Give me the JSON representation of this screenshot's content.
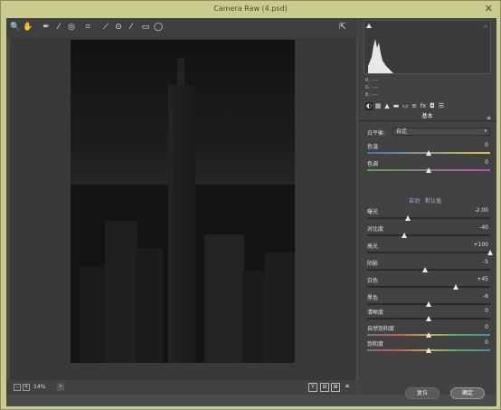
{
  "window": {
    "title": "Camera Raw (4.psd)",
    "close_glyph": "✕"
  },
  "toolbar": {
    "tools": [
      {
        "name": "zoom-icon",
        "glyph": "🔍"
      },
      {
        "name": "hand-icon",
        "glyph": "✋"
      },
      {
        "name": "white-balance-icon",
        "glyph": "✒"
      },
      {
        "name": "color-sampler-icon",
        "glyph": "⁄"
      },
      {
        "name": "targeted-adjust-icon",
        "glyph": "◎"
      },
      {
        "name": "crop-icon",
        "glyph": "⌗"
      },
      {
        "name": "straighten-icon",
        "glyph": "⟋"
      },
      {
        "name": "redeye-icon",
        "glyph": "⊙"
      },
      {
        "name": "brush-icon",
        "glyph": "⁄"
      },
      {
        "name": "graduated-filter-icon",
        "glyph": "▭"
      },
      {
        "name": "radial-filter-icon",
        "glyph": "◯"
      }
    ],
    "export_glyph": "⇱"
  },
  "histogram": {
    "r": "R :",
    "g": "G :",
    "b": "B :",
    "r_val": "---",
    "g_val": "---",
    "b_val": "---"
  },
  "panel_tabs": [
    "◐",
    "▦",
    "▲",
    "▬",
    "▭",
    "≡",
    "fx",
    "◘",
    "☰"
  ],
  "section": {
    "title": "基本",
    "menu": "≡"
  },
  "white_balance": {
    "label": "白平衡:",
    "value": "自定",
    "caret": "▾"
  },
  "sliders_a": [
    {
      "label": "色温",
      "value": "0",
      "pos": 0.5
    },
    {
      "label": "色调",
      "value": "0",
      "pos": 0.5
    }
  ],
  "auto": {
    "auto_label": "自动",
    "default_label": "默认值"
  },
  "sliders_b": [
    {
      "label": "曝光",
      "value": "-2.00",
      "pos": 0.33
    },
    {
      "label": "对比度",
      "value": "-40",
      "pos": 0.3
    },
    {
      "label": "高光",
      "value": "+100",
      "pos": 1.0
    },
    {
      "label": "阴影",
      "value": "-5",
      "pos": 0.47
    },
    {
      "label": "白色",
      "value": "+45",
      "pos": 0.72
    },
    {
      "label": "黑色",
      "value": "-6",
      "pos": 0.5
    }
  ],
  "sliders_c": [
    {
      "label": "清晰度",
      "value": "0",
      "pos": 0.5
    },
    {
      "label": "自然饱和度",
      "value": "0",
      "pos": 0.5
    },
    {
      "label": "饱和度",
      "value": "0",
      "pos": 0.5
    }
  ],
  "bottom": {
    "zoom": "14%",
    "zoom_arrow": "▾",
    "view_y": "Y",
    "view_split": "⊟",
    "view_side": "⊞",
    "view_menu": "≡"
  },
  "footer": {
    "reset": "复位",
    "ok": "确定"
  }
}
